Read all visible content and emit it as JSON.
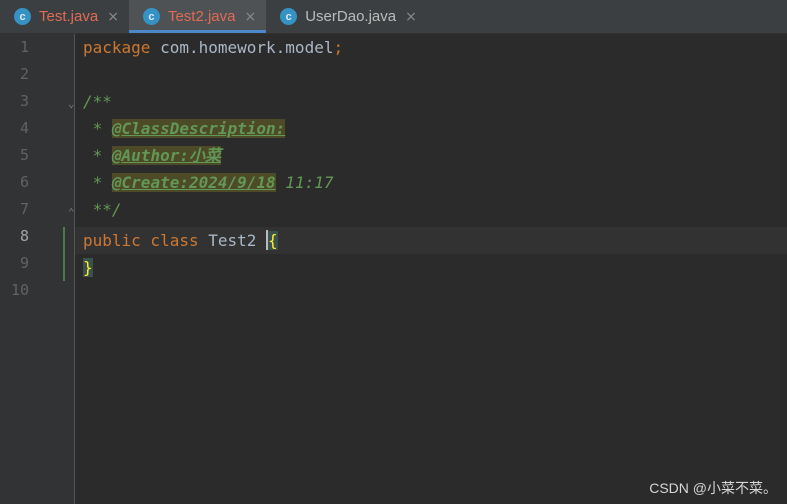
{
  "tabs": [
    {
      "label": "Test.java",
      "icon": "class-icon",
      "icon_letter": "c",
      "active": false,
      "modified": true,
      "close": "×"
    },
    {
      "label": "Test2.java",
      "icon": "class-icon",
      "icon_letter": "c",
      "active": true,
      "modified": true,
      "close": "×"
    },
    {
      "label": "UserDao.java",
      "icon": "class-icon",
      "icon_letter": "c",
      "active": false,
      "modified": false,
      "close": "×"
    }
  ],
  "editor": {
    "current_line": 8,
    "line_numbers": [
      "1",
      "2",
      "3",
      "4",
      "5",
      "6",
      "7",
      "8",
      "9",
      "10"
    ],
    "lines": {
      "l1_kw": "package",
      "l1_pkg": " com.homework.model",
      "l1_semi": ";",
      "l3_comment": "/**",
      "l4_prefix": " * ",
      "l4_tag": "@ClassDescription:",
      "l5_prefix": " * ",
      "l5_tag": "@Author:小菜",
      "l6_prefix": " * ",
      "l6_tag": "@Create:2024/9/18",
      "l6_rest": " 11:17",
      "l7_comment": " **/",
      "l8_kw1": "public",
      "l8_kw2": " class",
      "l8_name": " Test2 ",
      "l8_brace": "{",
      "l9_brace": "}"
    }
  },
  "watermark": "CSDN @小菜不菜。",
  "colors": {
    "background": "#2b2b2b",
    "keyword": "#cc7832",
    "comment": "#629755",
    "modified_tab": "#e06b55",
    "active_tab_underline": "#4a88c7"
  }
}
